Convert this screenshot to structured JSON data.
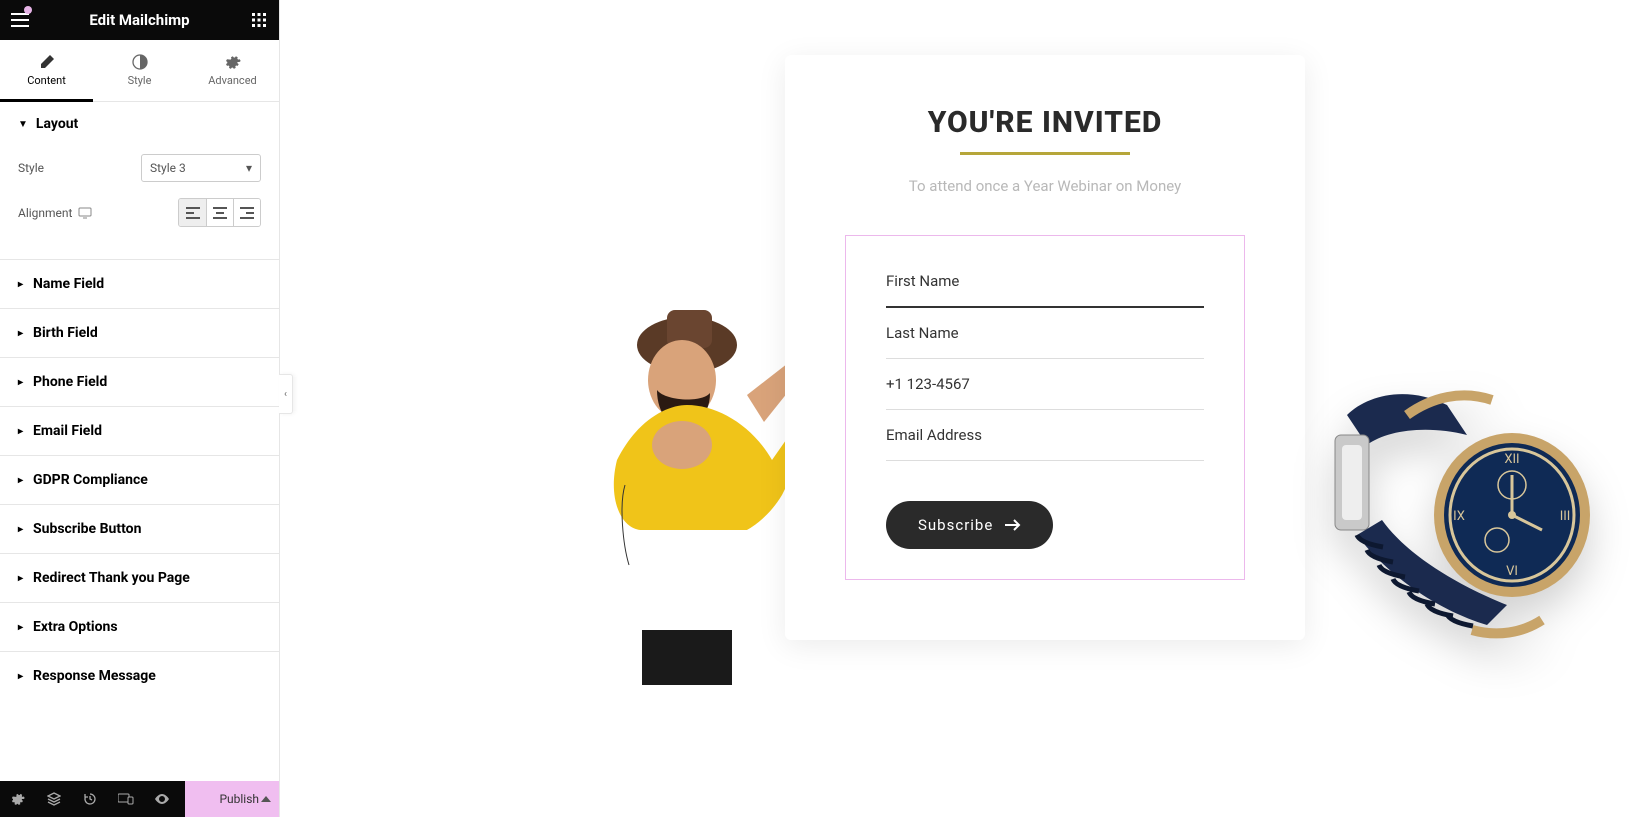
{
  "header": {
    "title": "Edit Mailchimp"
  },
  "tabs": [
    {
      "label": "Content",
      "active": true
    },
    {
      "label": "Style",
      "active": false
    },
    {
      "label": "Advanced",
      "active": false
    }
  ],
  "layout": {
    "heading": "Layout",
    "style_label": "Style",
    "style_value": "Style 3",
    "alignment_label": "Alignment"
  },
  "accordion": [
    "Name Field",
    "Birth Field",
    "Phone Field",
    "Email Field",
    "GDPR Compliance",
    "Subscribe Button",
    "Redirect Thank you Page",
    "Extra Options",
    "Response Message"
  ],
  "footer": {
    "publish": "Publish"
  },
  "preview": {
    "title": "YOU'RE INVITED",
    "subtitle": "To attend once a Year Webinar on Money",
    "first_name_ph": "First Name",
    "last_name_ph": "Last Name",
    "phone_ph": "+1 123-4567",
    "email_ph": "Email Address",
    "subscribe_label": "Subscribe"
  }
}
